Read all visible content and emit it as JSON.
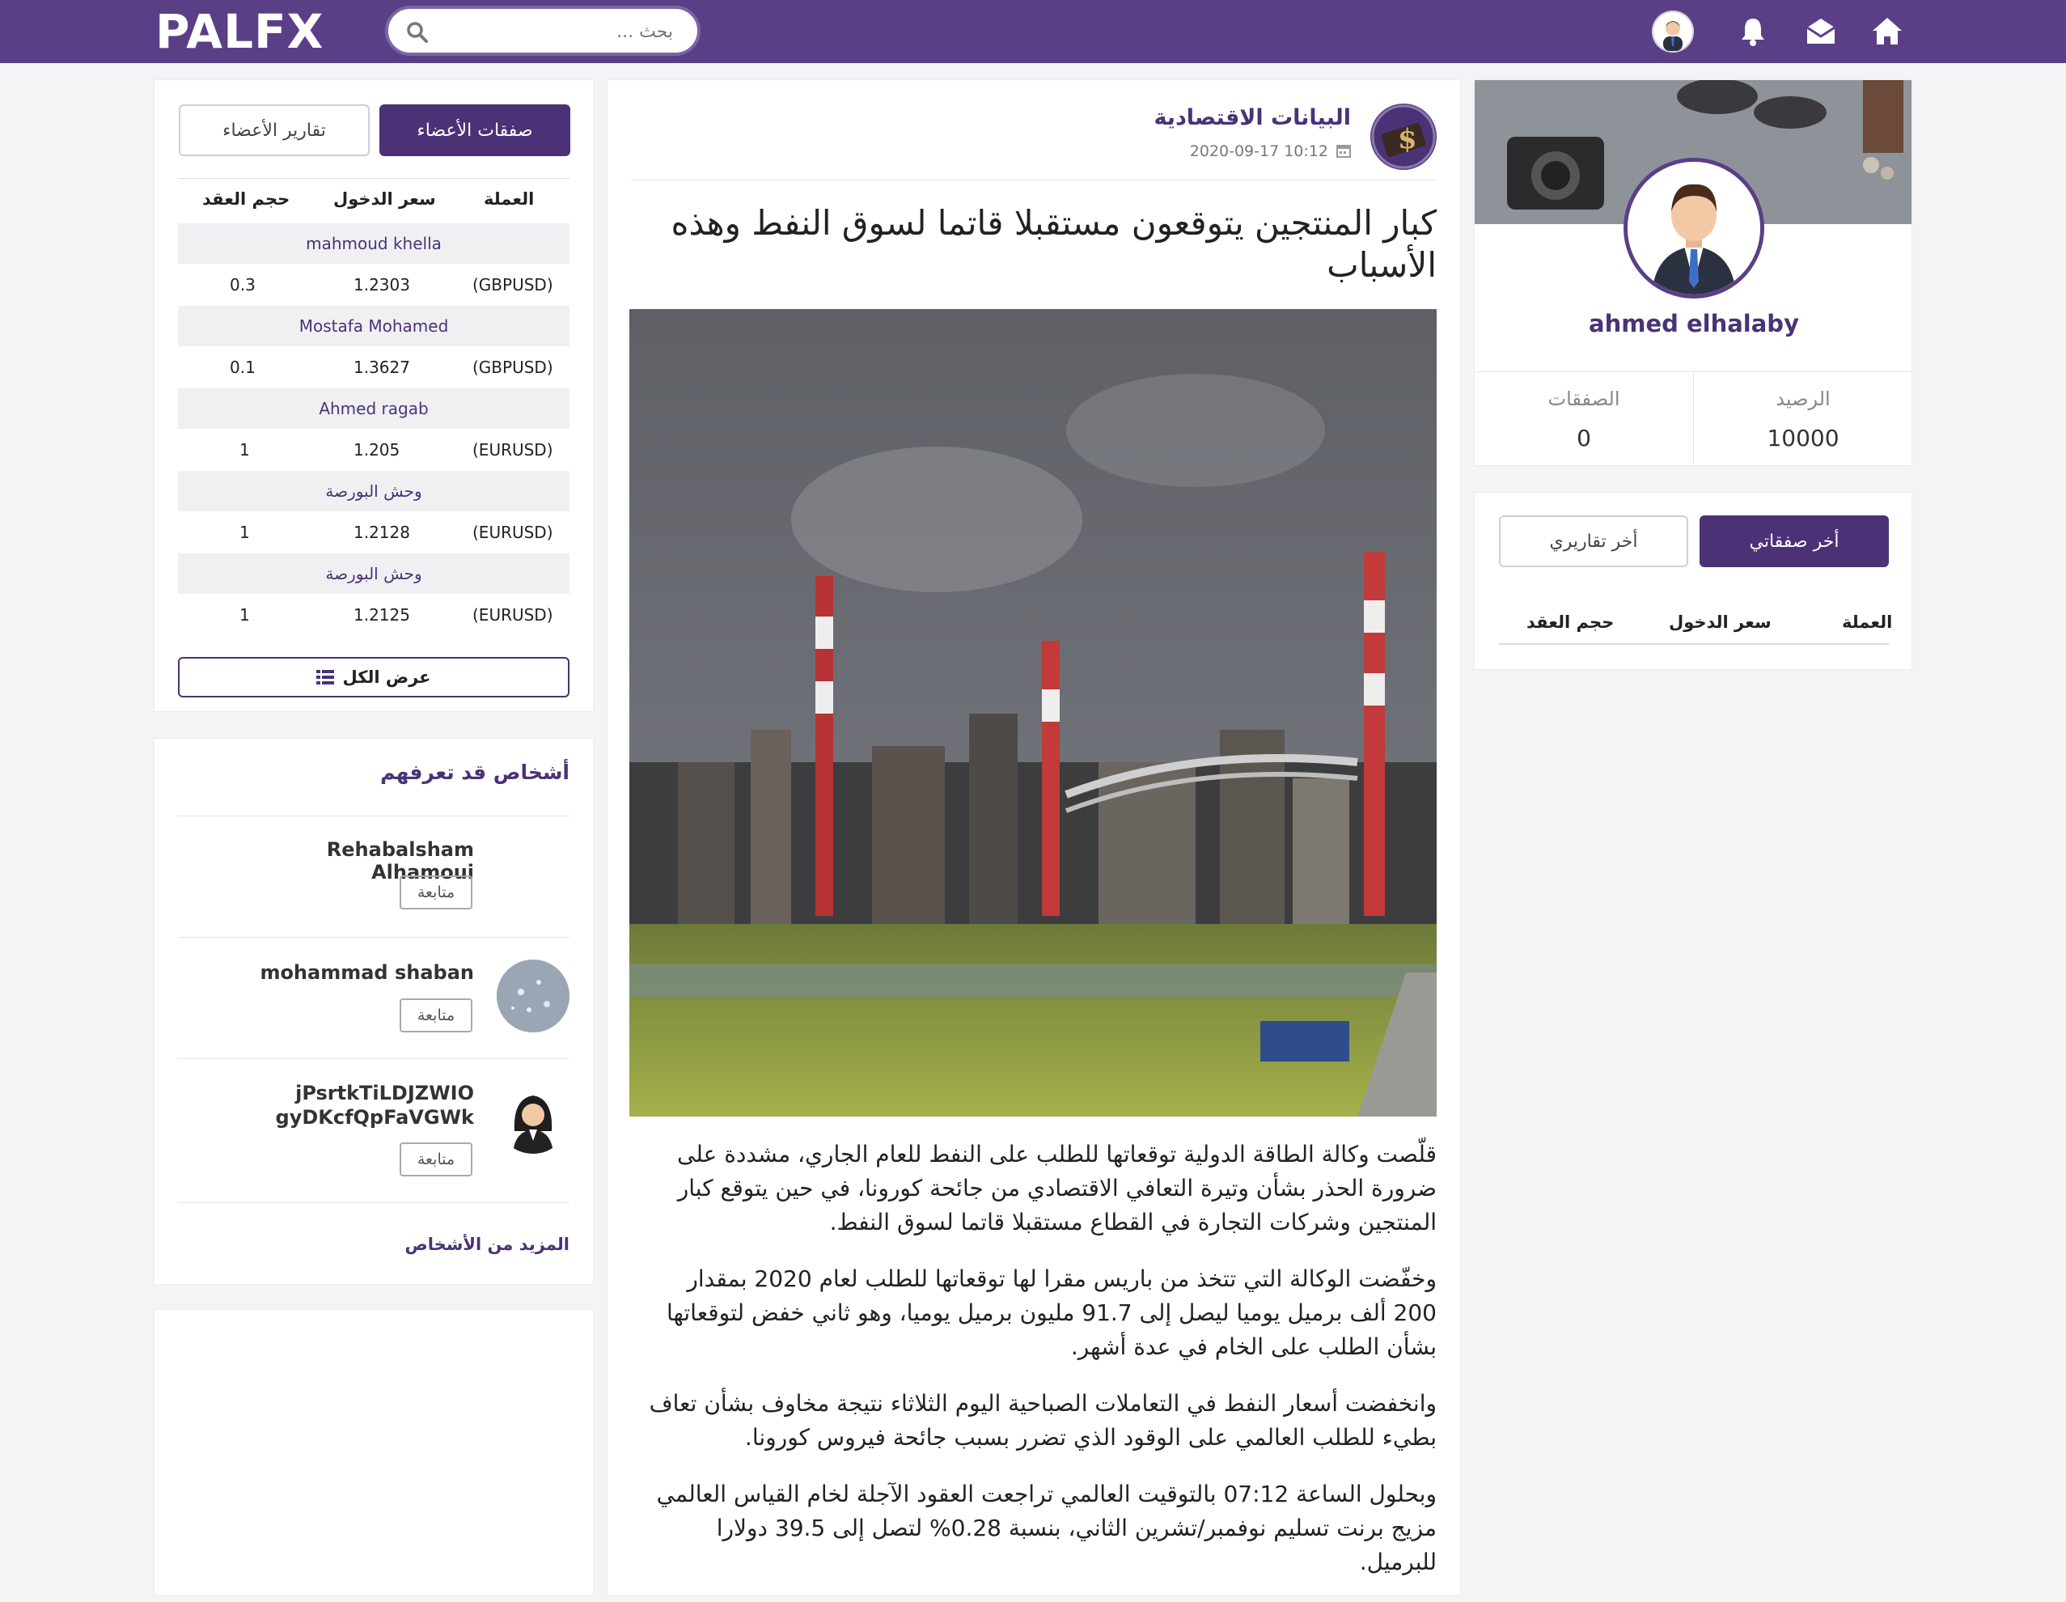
{
  "header": {
    "logo": "PALFX",
    "search_placeholder": "بحث ..."
  },
  "colors": {
    "brand": "#5a3f87",
    "brand_dark": "#4b3277"
  },
  "member_trades": {
    "tabs": [
      "صفقات الأعضاء",
      "تقارير الأعضاء"
    ],
    "columns": [
      "العملة",
      "سعر الدخول",
      "حجم العقد"
    ],
    "rows": [
      {
        "member": "mahmoud khella",
        "currency": "(GBPUSD)",
        "entry": "1.2303",
        "size": "0.3"
      },
      {
        "member": "Mostafa Mohamed",
        "currency": "(GBPUSD)",
        "entry": "1.3627",
        "size": "0.1"
      },
      {
        "member": "Ahmed ragab",
        "currency": "(EURUSD)",
        "entry": "1.205",
        "size": "1"
      },
      {
        "member": "وحش البورصة",
        "currency": "(EURUSD)",
        "entry": "1.2128",
        "size": "1"
      },
      {
        "member": "وحش البورصة",
        "currency": "(EURUSD)",
        "entry": "1.2125",
        "size": "1"
      }
    ],
    "view_all": "عرض الكل"
  },
  "people": {
    "title": "أشخاص قد تعرفهم",
    "list": [
      {
        "name": "Rehabalsham Alhamoui",
        "follow": "متابعة"
      },
      {
        "name": "mohammad shaban",
        "follow": "متابعة"
      },
      {
        "name": "jPsrtkTiLDJZWIO gyDKcfQpFaVGWk",
        "follow": "متابعة"
      }
    ],
    "more": "المزيد من الأشخاص"
  },
  "article": {
    "category": "البيانات الاقتصادية",
    "date": "2020-09-17 10:12",
    "title": "كبار المنتجين يتوقعون مستقبلا قاتما لسوق النفط وهذه الأسباب",
    "paragraphs": [
      "قلّصت وكالة الطاقة الدولية توقعاتها للطلب على النفط للعام الجاري، مشددة على ضرورة الحذر بشأن وتيرة التعافي الاقتصادي من جائحة كورونا، في حين يتوقع كبار المنتجين وشركات التجارة في القطاع مستقبلا قاتما لسوق النفط.",
      "وخفّضت الوكالة التي تتخذ من باريس مقرا لها توقعاتها للطلب لعام 2020 بمقدار 200 ألف برميل يوميا ليصل إلى 91.7 مليون برميل يوميا، وهو ثاني خفض لتوقعاتها بشأن الطلب على الخام في عدة أشهر.",
      "وانخفضت أسعار النفط في التعاملات الصباحية اليوم الثلاثاء نتيجة مخاوف بشأن تعاف بطيء للطلب العالمي على الوقود الذي تضرر بسبب جائحة فيروس كورونا.",
      "وبحلول الساعة 07:12 بالتوقيت العالمي تراجعت العقود الآجلة لخام القياس العالمي مزيج برنت تسليم نوفمبر/تشرين الثاني، بنسبة 0.28% لتصل إلى 39.5 دولارا للبرميل."
    ]
  },
  "profile": {
    "name": "ahmed elhalaby",
    "balance_label": "الرصيد",
    "balance": "10000",
    "trades_label": "الصفقات",
    "trades": "0"
  },
  "my_trades": {
    "tabs": [
      "أخر صفقاتي",
      "أخر تقاريري"
    ],
    "columns": [
      "العملة",
      "سعر الدخول",
      "حجم العقد"
    ]
  }
}
